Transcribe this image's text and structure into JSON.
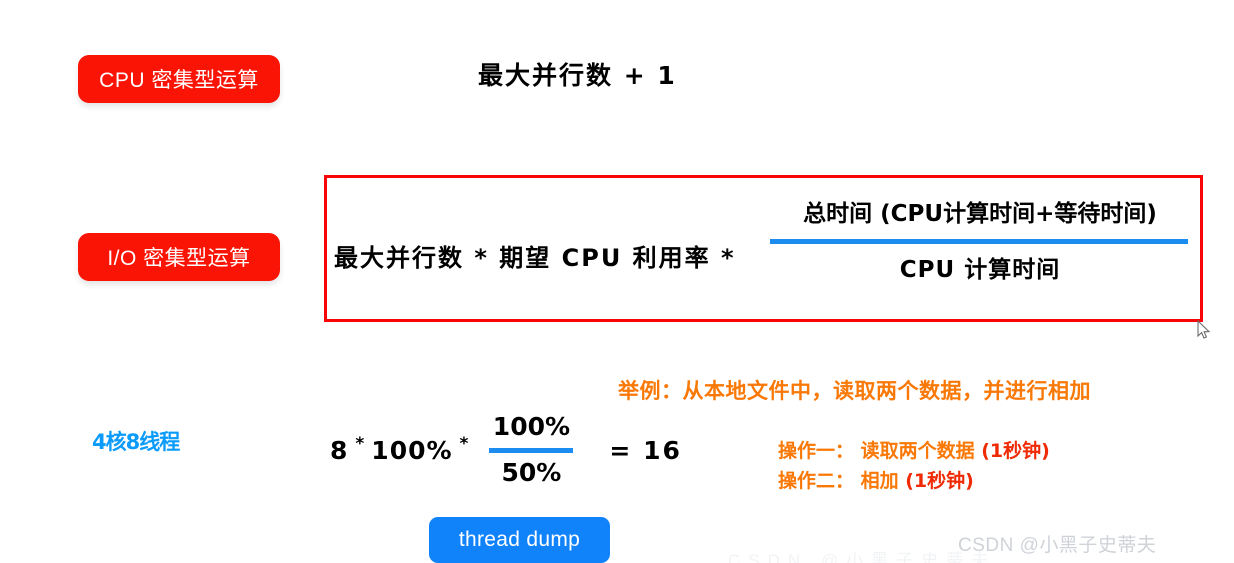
{
  "badges": {
    "cpu_intensive": "CPU 密集型运算",
    "io_intensive": "I/O 密集型运算"
  },
  "cpu_formula": {
    "expression": "最大并行数 + 1"
  },
  "io_formula": {
    "left_term": "最大并行数 *  期望 CPU 利用率  *",
    "numerator": "总时间 (CPU计算时间+等待时间)",
    "denominator": "CPU 计算时间",
    "box_border_color": "#fa0505",
    "fraction_bar_color": "#1d8cf0"
  },
  "example": {
    "cores_label": "4核8线程",
    "numeric": {
      "first_term": "8",
      "star_1": "*",
      "second_term": "100%",
      "star_2": "*",
      "fraction_numerator": "100%",
      "fraction_denominator": "50%",
      "result": "= 16"
    },
    "heading": "举例：从本地文件中，读取两个数据，并进行相加",
    "operations": [
      {
        "label": "操作一： 读取两个数据",
        "duration": "(1秒钟)"
      },
      {
        "label": "操作二： 相加",
        "duration": "(1秒钟)"
      }
    ],
    "accent_color": "#f97806",
    "duration_color": "#ef2a05"
  },
  "actions": {
    "thread_dump": "thread dump"
  },
  "watermark": {
    "main": "CSDN @小黑子史蒂夫",
    "faint": "CSDN @小黑子史蒂夫"
  }
}
